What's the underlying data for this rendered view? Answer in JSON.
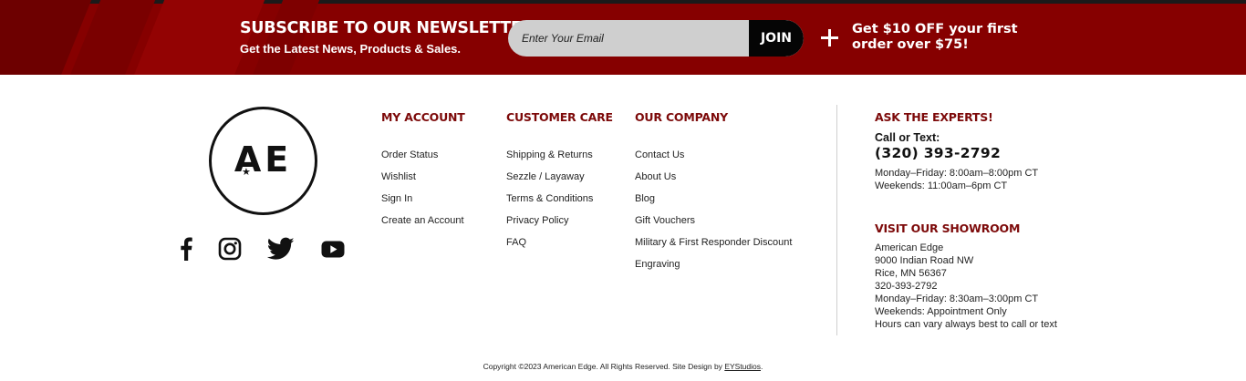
{
  "newsletter": {
    "title": "SUBSCRIBE TO OUR NEWSLETTER",
    "subtitle": "Get the Latest News, Products & Sales.",
    "email_placeholder": "Enter Your Email",
    "join_label": "JOIN",
    "offer_text": "Get $10 OFF your first order over $75!",
    "plus_icon": "plus-icon"
  },
  "colors": {
    "banner_red": "#860000",
    "heading_red": "#7d0a0a",
    "join_black": "#050505"
  },
  "logo": {
    "text": "AE",
    "star": "★"
  },
  "social": [
    "facebook-icon",
    "instagram-icon",
    "twitter-icon",
    "youtube-icon"
  ],
  "columns": {
    "my_account": {
      "title": "MY ACCOUNT",
      "links": [
        "Order Status",
        "Wishlist",
        "Sign In",
        "Create an Account"
      ]
    },
    "customer_care": {
      "title": "CUSTOMER CARE",
      "links": [
        "Shipping & Returns",
        "Sezzle / Layaway",
        "Terms & Conditions",
        "Privacy Policy",
        "FAQ"
      ]
    },
    "our_company": {
      "title": "OUR COMPANY",
      "links": [
        "Contact Us",
        "About Us",
        "Blog",
        "Gift Vouchers",
        "Military & First Responder Discount",
        "Engraving"
      ]
    }
  },
  "experts": {
    "title": "ASK THE EXPERTS!",
    "call_label": "Call or Text:",
    "phone": "(320) 393-2792",
    "hours": [
      "Monday–Friday: 8:00am–8:00pm CT",
      "Weekends: 11:00am–6pm CT"
    ]
  },
  "showroom": {
    "title": "VISIT OUR SHOWROOM",
    "lines": [
      "American Edge",
      "9000 Indian Road NW",
      "Rice, MN 56367",
      "320-393-2792",
      "Monday–Friday: 8:30am–3:00pm CT",
      "Weekends: Appointment Only",
      "Hours can vary always best to call or text"
    ]
  },
  "footer": {
    "copyright": "Copyright ©2023 American Edge. All Rights Reserved. Site Design by ",
    "designer": "EYStudios",
    "period": "."
  }
}
